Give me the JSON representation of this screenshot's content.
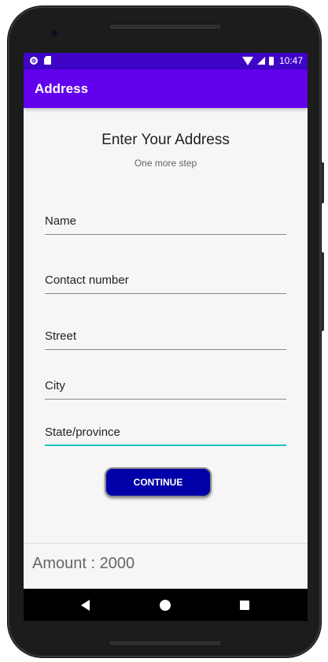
{
  "status_bar": {
    "time": "10:47"
  },
  "app_bar": {
    "title": "Address"
  },
  "form": {
    "heading": "Enter Your Address",
    "subheading": "One more step",
    "fields": [
      {
        "placeholder": "Name",
        "value": ""
      },
      {
        "placeholder": "Contact number",
        "value": ""
      },
      {
        "placeholder": "Street",
        "value": ""
      },
      {
        "placeholder": "City",
        "value": ""
      },
      {
        "placeholder": "State/province",
        "value": ""
      }
    ],
    "continue_label": "CONTINUE"
  },
  "footer": {
    "amount_text": "Amount : 2000"
  },
  "nav_bar": {
    "icons": [
      "back-icon",
      "home-icon",
      "recents-icon"
    ]
  },
  "colors": {
    "status_bar": "#3f04c6",
    "app_bar": "#6200ee",
    "button": "#0000a8",
    "focused_underline": "#1dc4c0"
  }
}
